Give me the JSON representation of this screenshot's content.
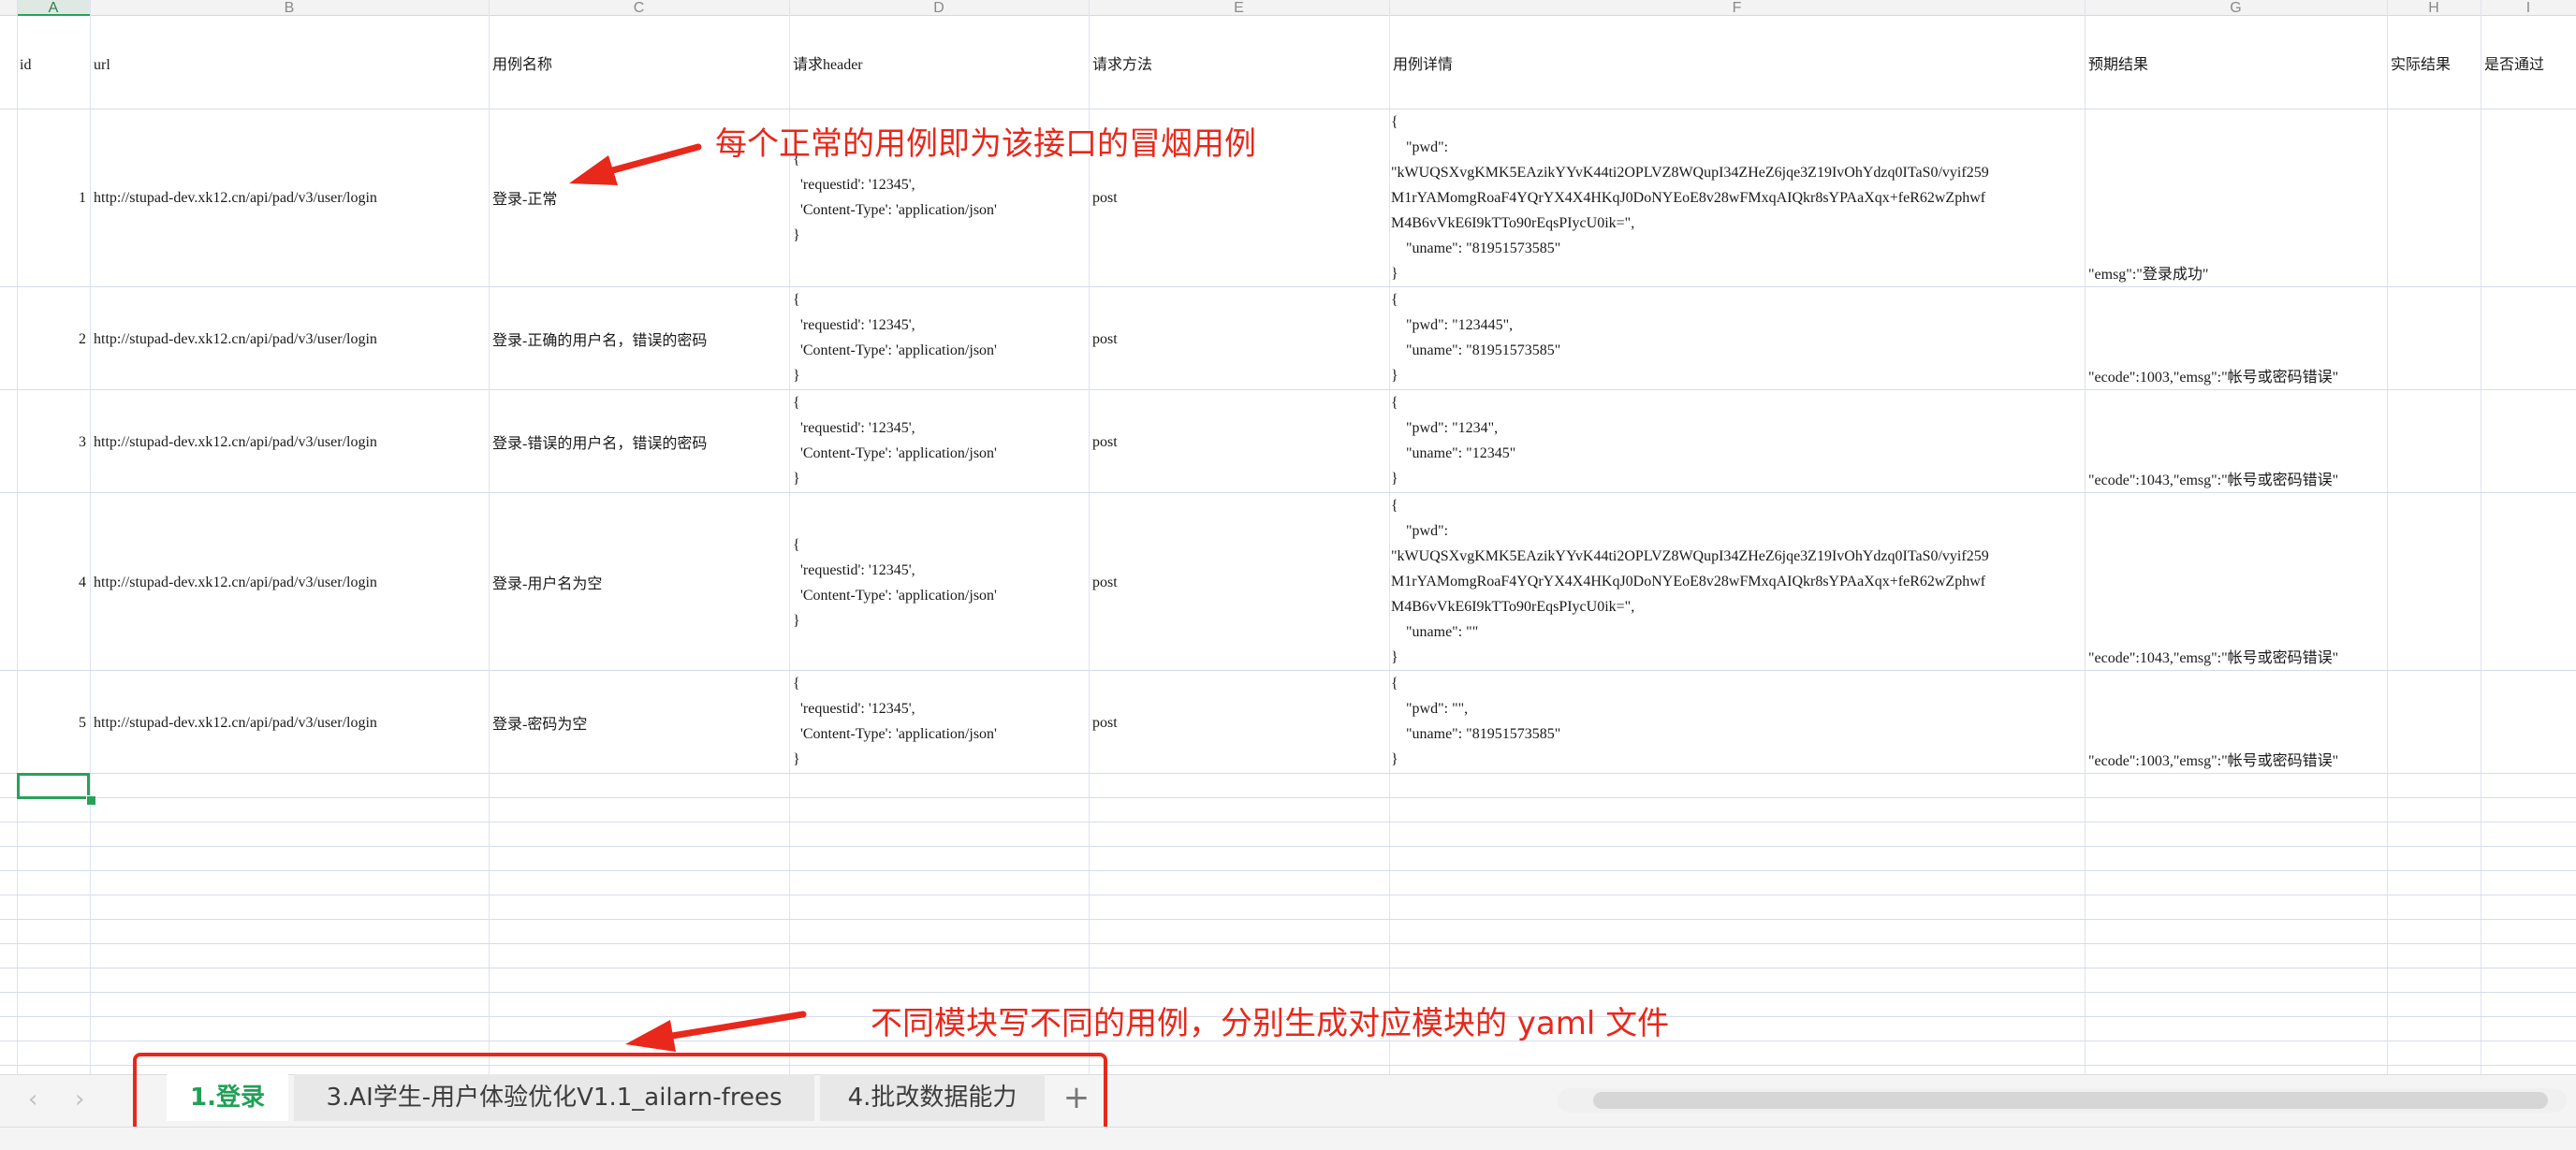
{
  "columns": [
    "A",
    "B",
    "C",
    "D",
    "E",
    "F",
    "G",
    "H",
    "I"
  ],
  "selected_column": "A",
  "header_row": {
    "id": "id",
    "url": "url",
    "case_name": "用例名称",
    "request_header": "请求header",
    "request_method": "请求方法",
    "case_detail": "用例详情",
    "expected": "预期结果",
    "actual": "实际结果",
    "passed": "是否通过"
  },
  "rows": [
    {
      "id": "1",
      "url": "http://stupad-dev.xk12.cn/api/pad/v3/user/login",
      "name": "登录-正常",
      "header": "{\n  'requestid': '12345',\n  'Content-Type': 'application/json'\n}",
      "method": "post",
      "detail": "{\n    \"pwd\":\n\"kWUQSXvgKMK5EAzikYYvK44ti2OPLVZ8WQupI34ZHeZ6jqe3Z19IvOhYdzq0ITaS0/vyif259\nM1rYAMomgRoaF4YQrYX4X4HKqJ0DoNYEoE8v28wFMxqAIQkr8sYPAaXqx+feR62wZphwf\nM4B6vVkE6I9kTTo90rEqsPIycU0ik=\",\n    \"uname\": \"81951573585\"\n}",
      "expected": "\"emsg\":\"登录成功\""
    },
    {
      "id": "2",
      "url": "http://stupad-dev.xk12.cn/api/pad/v3/user/login",
      "name": "登录-正确的用户名，错误的密码",
      "header": "{\n  'requestid': '12345',\n  'Content-Type': 'application/json'\n}",
      "method": "post",
      "detail": "{\n    \"pwd\": \"123445\",\n    \"uname\": \"81951573585\"\n}",
      "expected": "\"ecode\":1003,\"emsg\":\"帐号或密码错误\""
    },
    {
      "id": "3",
      "url": "http://stupad-dev.xk12.cn/api/pad/v3/user/login",
      "name": "登录-错误的用户名，错误的密码",
      "header": "{\n  'requestid': '12345',\n  'Content-Type': 'application/json'\n}",
      "method": "post",
      "detail": "{\n    \"pwd\": \"1234\",\n    \"uname\": \"12345\"\n}",
      "expected": "\"ecode\":1043,\"emsg\":\"帐号或密码错误\""
    },
    {
      "id": "4",
      "url": "http://stupad-dev.xk12.cn/api/pad/v3/user/login",
      "name": "登录-用户名为空",
      "header": "{\n  'requestid': '12345',\n  'Content-Type': 'application/json'\n}",
      "method": "post",
      "detail": "{\n    \"pwd\":\n\"kWUQSXvgKMK5EAzikYYvK44ti2OPLVZ8WQupI34ZHeZ6jqe3Z19IvOhYdzq0ITaS0/vyif259\nM1rYAMomgRoaF4YQrYX4X4HKqJ0DoNYEoE8v28wFMxqAIQkr8sYPAaXqx+feR62wZphwf\nM4B6vVkE6I9kTTo90rEqsPIycU0ik=\",\n    \"uname\": \"\"\n}",
      "expected": "\"ecode\":1043,\"emsg\":\"帐号或密码错误\""
    },
    {
      "id": "5",
      "url": "http://stupad-dev.xk12.cn/api/pad/v3/user/login",
      "name": "登录-密码为空",
      "header": "{\n  'requestid': '12345',\n  'Content-Type': 'application/json'\n}",
      "method": "post",
      "detail": "{\n    \"pwd\": \"\",\n    \"uname\": \"81951573585\"\n}",
      "expected": "\"ecode\":1003,\"emsg\":\"帐号或密码错误\""
    }
  ],
  "annotations": {
    "top": "每个正常的用例即为该接口的冒烟用例",
    "bottom": "不同模块写不同的用例，分别生成对应模块的 yaml 文件"
  },
  "sheet_tabs": [
    "1.登录",
    "3.AI学生-用户体验优化V1.1_ailarn-frees",
    "4.批改数据能力"
  ],
  "active_tab": "1.登录",
  "add_tab_label": "+",
  "accent_color": "#2aa15a",
  "annotation_color": "#e8281b"
}
